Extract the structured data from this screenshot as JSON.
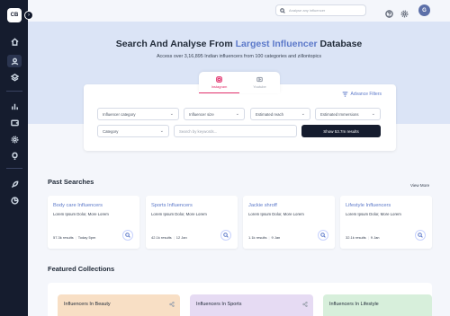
{
  "sidebar": {
    "logo_text": "CB",
    "collapse_icon": "chevron-right-icon",
    "items": [
      {
        "icon": "home-icon"
      },
      {
        "icon": "user-icon",
        "active": true
      },
      {
        "icon": "layers-icon"
      },
      {
        "icon": "bar-chart-icon"
      },
      {
        "icon": "wallet-icon"
      },
      {
        "icon": "gear-icon"
      },
      {
        "icon": "bulb-icon"
      },
      {
        "icon": "rocket-icon"
      },
      {
        "icon": "pie-chart-icon"
      }
    ]
  },
  "topbar": {
    "search_placeholder": "Analyse any influencer",
    "avatar_initial": "G"
  },
  "hero": {
    "title_part1": "Search And Analyse From ",
    "title_accent": "Largest Influencer",
    "title_part2": " Database",
    "subtitle": "Access over 3,16,895 Indian influencers from 100 categories and zillontopics"
  },
  "search_panel": {
    "tabs": [
      {
        "label": "Instagram",
        "active": true
      },
      {
        "label": "Youtube",
        "active": false
      }
    ],
    "advanced_filters": "Advance Filters",
    "filters": [
      "Influencer category",
      "Influencer size",
      "Estimated reach",
      "Estimated Immersions"
    ],
    "category": "Category",
    "keyword_placeholder": "Search by keywords...",
    "show_button": "Show 53.7m results"
  },
  "past_searches": {
    "title": "Past Searches",
    "view_more": "View More",
    "cards": [
      {
        "title": "Body care Influencers",
        "desc": "Lorem Ipsum Dolor, More Lorem",
        "results": "57.3k results",
        "date": "Today 5pm"
      },
      {
        "title": "Sports Influencers",
        "desc": "Lorem Ipsum Dolor, More Lorem",
        "results": "42.1k results",
        "date": "12 Jan"
      },
      {
        "title": "Jackie shroff",
        "desc": "Lorem Ipsum Dolor, More Lorem",
        "results": "1.1k results",
        "date": "9 Jan"
      },
      {
        "title": "Lifestyle Influencers",
        "desc": "Lorem Ipsum Dolor, More Lorem",
        "results": "32.1k results",
        "date": "9 Jan"
      }
    ]
  },
  "featured": {
    "title": "Featured Collections",
    "items": [
      {
        "label": "Influencers In Beauty",
        "color": "#f8dfc5"
      },
      {
        "label": "Influencers In Sports",
        "color": "#e6dbf3"
      },
      {
        "label": "Influencers In Lifestyle",
        "color": "#d7efdb"
      }
    ]
  },
  "colors": {
    "accent": "#5c79c9",
    "sidebar": "#151c2e",
    "instagram": "#e1306c"
  }
}
